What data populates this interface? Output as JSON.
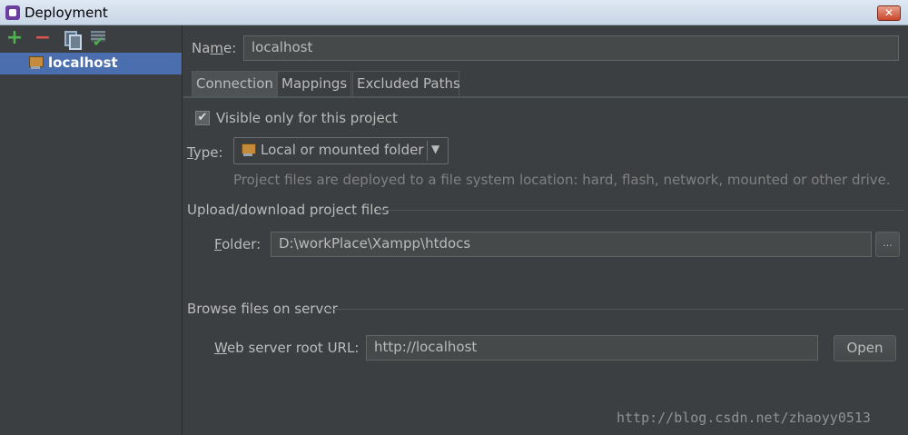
{
  "window": {
    "title": "Deployment",
    "close_label": "✕"
  },
  "toolbar": {
    "add": "+",
    "remove": "−"
  },
  "servers": [
    {
      "label": "localhost"
    }
  ],
  "name": {
    "label_pre": "Na",
    "label_mnemonic": "m",
    "label_post": "e:",
    "value": "localhost"
  },
  "tabs": [
    {
      "label": "Connection"
    },
    {
      "label": "Mappings"
    },
    {
      "label": "Excluded Paths"
    }
  ],
  "connection": {
    "visible_only_label": "Visible only for this project",
    "visible_only_checked": true,
    "type_label_mnemonic": "T",
    "type_label_post": "ype:",
    "type_value": "Local or mounted folder",
    "type_hint": "Project files are deployed to a file system location: hard, flash, network, mounted or other drive.",
    "upload_section": "Upload/download project files",
    "folder_label_mnemonic": "F",
    "folder_label_post": "older:",
    "folder_value": "D:\\workPlace\\Xampp\\htdocs",
    "browse_button": "...",
    "browse_section": "Browse files on server",
    "web_root_label_mnemonic": "W",
    "web_root_label_post": "eb server root URL:",
    "web_root_value": "http://localhost",
    "open_button": "Open"
  },
  "watermark": "http://blog.csdn.net/zhaoyy0513"
}
